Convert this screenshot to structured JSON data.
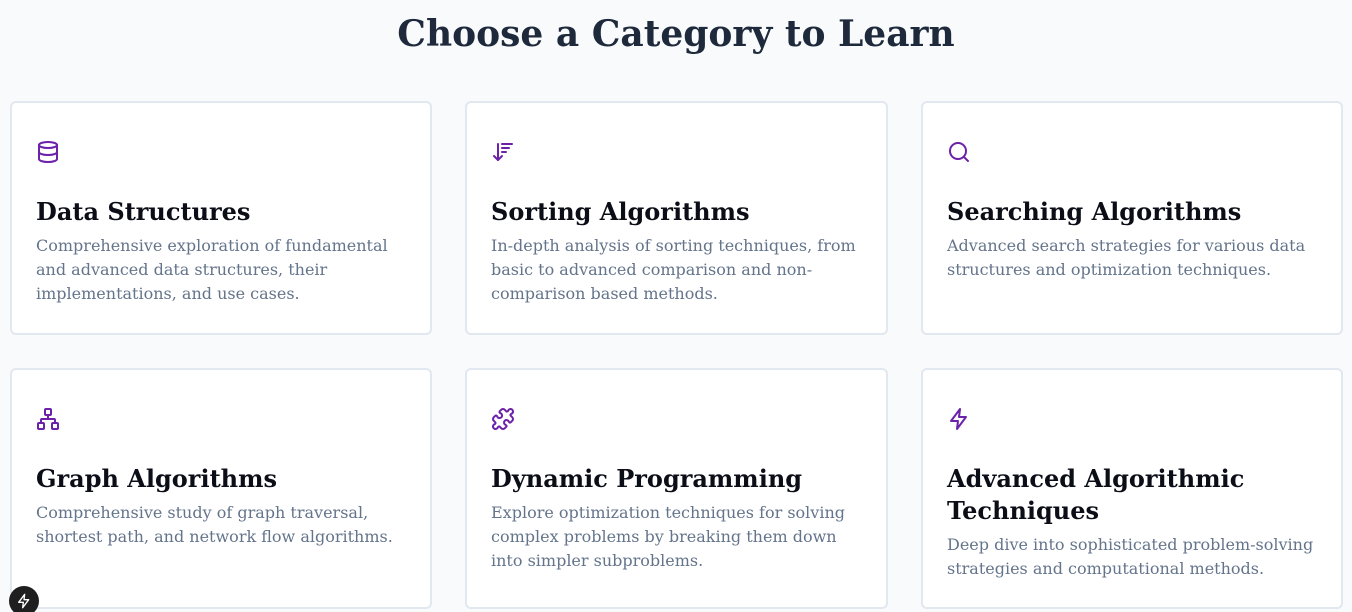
{
  "page": {
    "title": "Choose a Category to Learn"
  },
  "colors": {
    "accent": "#6b21a8",
    "background": "#f8fafc",
    "card_border": "#e2e8f0",
    "title_text": "#1e293b",
    "description_text": "#64748b"
  },
  "categories": [
    {
      "icon": "database-icon",
      "title": "Data Structures",
      "description": "Comprehensive exploration of fundamental and advanced data structures, their implementations, and use cases."
    },
    {
      "icon": "sort-descending-icon",
      "title": "Sorting Algorithms",
      "description": "In-depth analysis of sorting techniques, from basic to advanced comparison and non-comparison based methods."
    },
    {
      "icon": "search-icon",
      "title": "Searching Algorithms",
      "description": "Advanced search strategies for various data structures and optimization techniques."
    },
    {
      "icon": "network-icon",
      "title": "Graph Algorithms",
      "description": "Comprehensive study of graph traversal, shortest path, and network flow algorithms."
    },
    {
      "icon": "puzzle-icon",
      "title": "Dynamic Programming",
      "description": "Explore optimization techniques for solving complex problems by breaking them down into simpler subproblems."
    },
    {
      "icon": "lightning-icon",
      "title": "Advanced Algorithmic Techniques",
      "description": "Deep dive into sophisticated problem-solving strategies and computational methods."
    }
  ],
  "floating_button": {
    "icon": "lightning-icon"
  }
}
